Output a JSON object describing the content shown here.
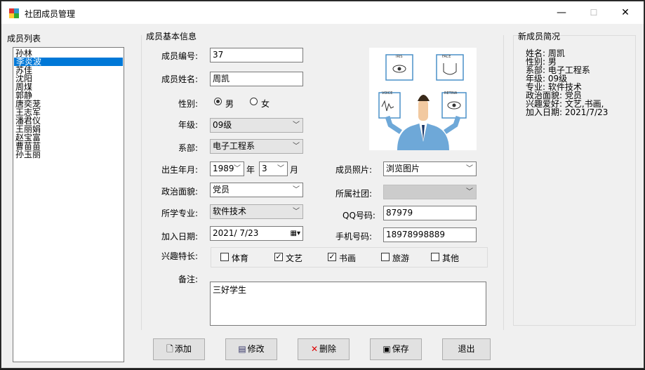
{
  "window": {
    "title": "社团成员管理",
    "minimize": "—",
    "maximize": "☐",
    "close": "✕"
  },
  "member_list": {
    "label": "成员列表",
    "items": [
      "孙林",
      "李炎波",
      "苏佳",
      "沈阳",
      "周煤",
      "郭静",
      "唐奕茏",
      "王志军",
      "潘君仪",
      "王丽娟",
      "赵宝富",
      "曹苗苗",
      "孙玉丽"
    ],
    "selected_index": 1
  },
  "form": {
    "group_label": "成员基本信息",
    "id_label": "成员编号:",
    "id_value": "37",
    "name_label": "成员姓名:",
    "name_value": "周凯",
    "gender_label": "性别:",
    "male": "男",
    "female": "女",
    "gender_selected": "男",
    "grade_label": "年级:",
    "grade_value": "09级",
    "dept_label": "系部:",
    "dept_value": "电子工程系",
    "birth_label": "出生年月:",
    "birth_year": "1989",
    "year_unit": "年",
    "birth_month": "3",
    "month_unit": "月",
    "photo_label": "成员照片:",
    "photo_value": "浏览图片",
    "politics_label": "政治面貌:",
    "politics_value": "党员",
    "club_label": "所属社团:",
    "club_value": "",
    "major_label": "所学专业:",
    "major_value": "软件技术",
    "qq_label": "QQ号码:",
    "qq_value": "87979",
    "join_label": "加入日期:",
    "join_value": "2021/ 7/23",
    "phone_label": "手机号码:",
    "phone_value": "18978998889",
    "hobby_label": "兴趣特长:",
    "hobbies": [
      {
        "label": "体育",
        "checked": false
      },
      {
        "label": "文艺",
        "checked": true
      },
      {
        "label": "书画",
        "checked": true
      },
      {
        "label": "旅游",
        "checked": false
      },
      {
        "label": "其他",
        "checked": false
      }
    ],
    "remark_label": "备注:",
    "remark_value": "三好学生",
    "photo_tags": [
      "IRIS",
      "FACE",
      "VOICE",
      "RETINA"
    ]
  },
  "summary": {
    "label": "新成员简况",
    "lines": [
      "姓名: 周凯",
      "性别: 男",
      "系部: 电子工程系",
      "年级: 09级",
      "专业: 软件技术",
      "政治面貌: 党员",
      "兴趣爱好: 文艺,书画,",
      "加入日期: 2021/7/23"
    ]
  },
  "buttons": {
    "add": "添加",
    "edit": "修改",
    "delete": "删除",
    "save": "保存",
    "exit": "退出"
  },
  "colors": {
    "selection": "#0078d7",
    "window_bg": "#f0f0f0"
  }
}
